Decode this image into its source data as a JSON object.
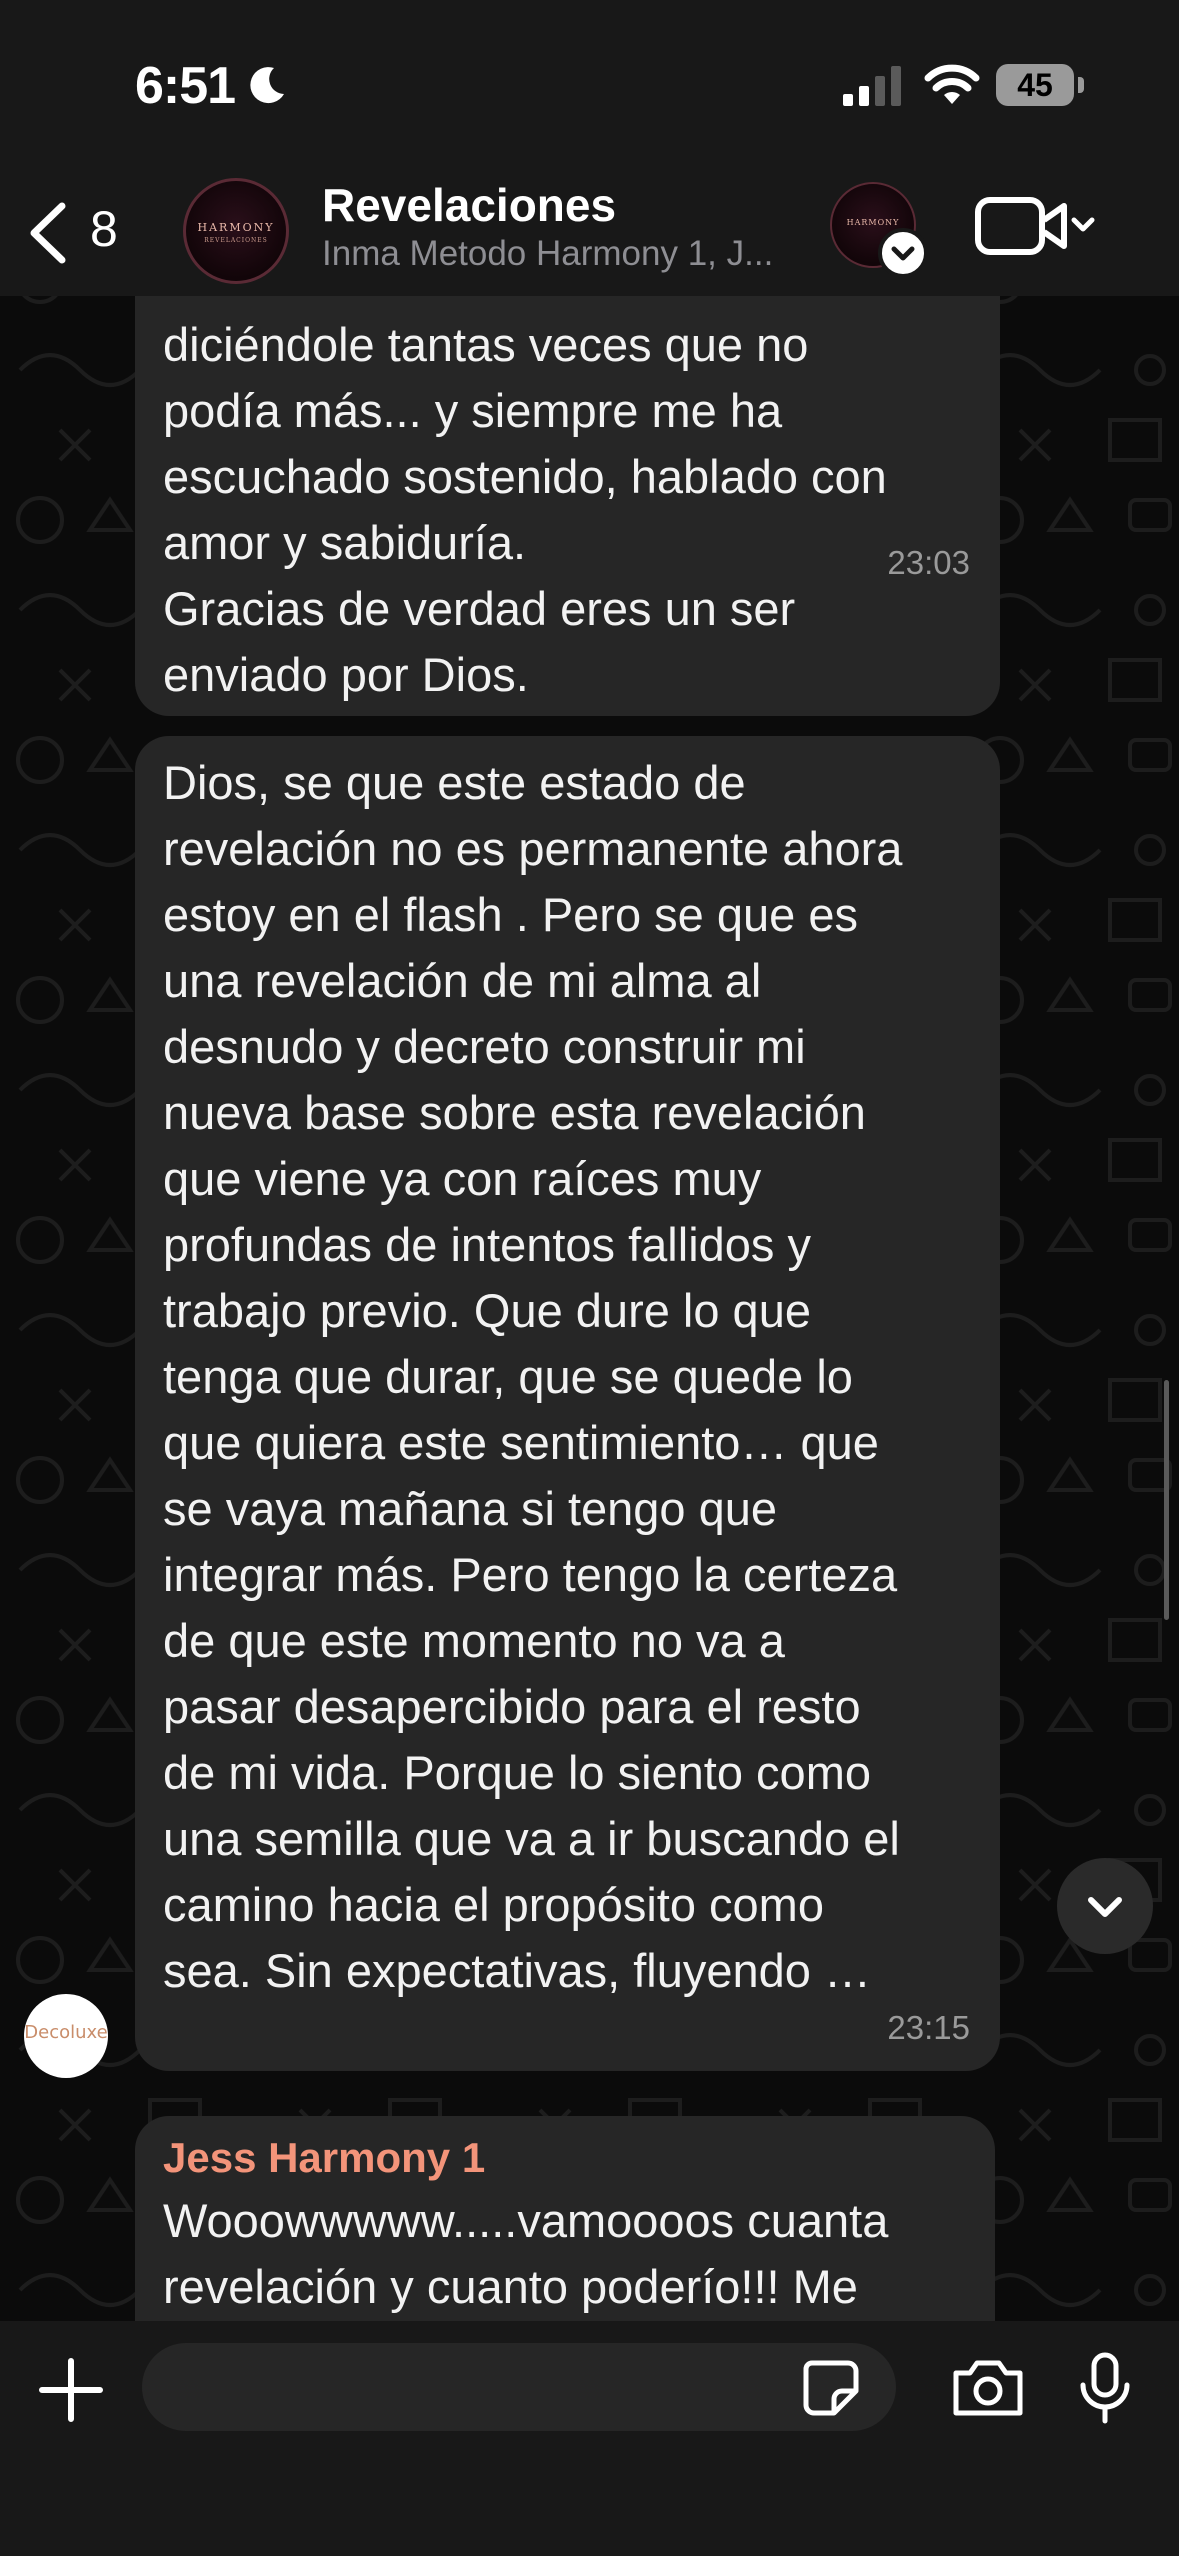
{
  "status_bar": {
    "time": "6:51",
    "battery": "45"
  },
  "header": {
    "back_count": "8",
    "title": "Revelaciones",
    "subtitle": "Inma Metodo Harmony 1, J...",
    "avatar_text_main": "HARMONY",
    "avatar_text_sub": "REVELACIONES",
    "mini_avatar_text": "HARMONY"
  },
  "messages": [
    {
      "text": "diciéndole tantas veces que no\npodía más... y siempre me ha\nescuchado sostenido, hablado con\namor y sabiduría.\nGracias de verdad eres un ser\nenviado por Dios.",
      "time": "23:03"
    },
    {
      "text": "Dios, se que este estado de\nrevelación no es permanente ahora\nestoy en el flash . Pero se que es\nuna revelación de mi alma al\ndesnudo y decreto construir mi\nnueva base sobre esta revelación\nque viene ya con raíces muy\nprofundas de intentos fallidos y\ntrabajo previo. Que dure lo que\ntenga que durar, que se quede lo\nque quiera este sentimiento… que\nse vaya mañana si tengo que\nintegrar más. Pero tengo la certeza\nde que este momento no va a\npasar desapercibido para el resto\nde mi vida. Porque lo siento como\nuna semilla que va a ir buscando el\ncamino hacia el propósito como\nsea. Sin expectativas,   fluyendo …",
      "time": "23:15",
      "avatar_text": "Decoluxe"
    },
    {
      "sender": "Jess Harmony 1",
      "text": "Wooowwwww.....vamoooos cuanta\nrevelación y cuanto poderío!!! Me"
    }
  ],
  "colors": {
    "sender_name": "#f3947a",
    "bubble": "#262626",
    "header": "#181818"
  }
}
